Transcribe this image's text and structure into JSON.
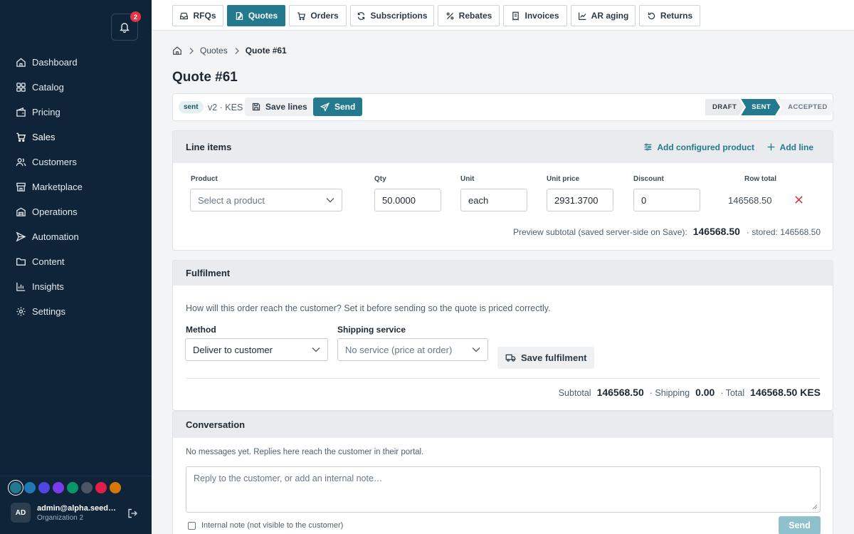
{
  "notifications": {
    "count": "2"
  },
  "sidebar": {
    "items": [
      {
        "label": "Dashboard",
        "icon": "home-icon"
      },
      {
        "label": "Catalog",
        "icon": "grid-icon"
      },
      {
        "label": "Pricing",
        "icon": "wallet-icon"
      },
      {
        "label": "Sales",
        "icon": "cart-icon"
      },
      {
        "label": "Customers",
        "icon": "users-icon"
      },
      {
        "label": "Marketplace",
        "icon": "store-icon"
      },
      {
        "label": "Operations",
        "icon": "building-icon"
      },
      {
        "label": "Automation",
        "icon": "send-icon"
      },
      {
        "label": "Content",
        "icon": "folder-icon"
      },
      {
        "label": "Insights",
        "icon": "bar-chart-icon"
      },
      {
        "label": "Settings",
        "icon": "gear-icon"
      }
    ],
    "active": "Sales",
    "theme_colors": [
      "#237a8e",
      "#1f77b4",
      "#4f46e5",
      "#7c3aed",
      "#059669",
      "#4b5563",
      "#e11d48",
      "#d97706"
    ],
    "user": {
      "initials": "AD",
      "email": "admin@alpha.seed.local",
      "org": "Organization 2"
    }
  },
  "tabs": [
    {
      "label": "RFQs",
      "icon": "inbox-icon"
    },
    {
      "label": "Quotes",
      "icon": "edit-document-icon"
    },
    {
      "label": "Orders",
      "icon": "cart-icon"
    },
    {
      "label": "Subscriptions",
      "icon": "refresh-icon"
    },
    {
      "label": "Rebates",
      "icon": "percent-icon"
    },
    {
      "label": "Invoices",
      "icon": "receipt-icon"
    },
    {
      "label": "AR aging",
      "icon": "trend-icon"
    },
    {
      "label": "Returns",
      "icon": "undo-icon"
    }
  ],
  "active_tab": "Quotes",
  "breadcrumb": {
    "parent": "Quotes",
    "current": "Quote #61"
  },
  "page_title": "Quote #61",
  "quote": {
    "status": "sent",
    "version_currency": "v2 · KES",
    "save_lines_label": "Save lines",
    "send_label": "Send",
    "steps": [
      "DRAFT",
      "SENT",
      "ACCEPTED"
    ],
    "current_step": "SENT"
  },
  "line_items": {
    "title": "Line items",
    "add_configured_label": "Add configured product",
    "add_line_label": "Add line",
    "columns": [
      "Product",
      "Qty",
      "Unit",
      "Unit price",
      "Discount",
      "Row total"
    ],
    "rows": [
      {
        "product_placeholder": "Select a product",
        "qty": "50.0000",
        "unit": "each",
        "unit_price": "2931.3700",
        "discount": "0",
        "row_total": "146568.50"
      }
    ],
    "preview_label": "Preview subtotal (saved server-side on Save):",
    "preview_value": "146568.50",
    "stored_label": "· stored: 146568.50"
  },
  "fulfilment": {
    "title": "Fulfilment",
    "help": "How will this order reach the customer? Set it before sending so the quote is priced correctly.",
    "method_label": "Method",
    "method_value": "Deliver to customer",
    "service_label": "Shipping service",
    "service_value": "No service (price at order)",
    "save_label": "Save fulfilment",
    "subtotal_label": "Subtotal",
    "subtotal_value": "146568.50",
    "shipping_label": "· Shipping",
    "shipping_value": "0.00",
    "total_label": "· Total",
    "total_value": "146568.50 KES"
  },
  "conversation": {
    "title": "Conversation",
    "empty_note": "No messages yet. Replies here reach the customer in their portal.",
    "placeholder": "Reply to the customer, or add an internal note…",
    "internal_label": "Internal note (not visible to the customer)",
    "send_label": "Send"
  }
}
